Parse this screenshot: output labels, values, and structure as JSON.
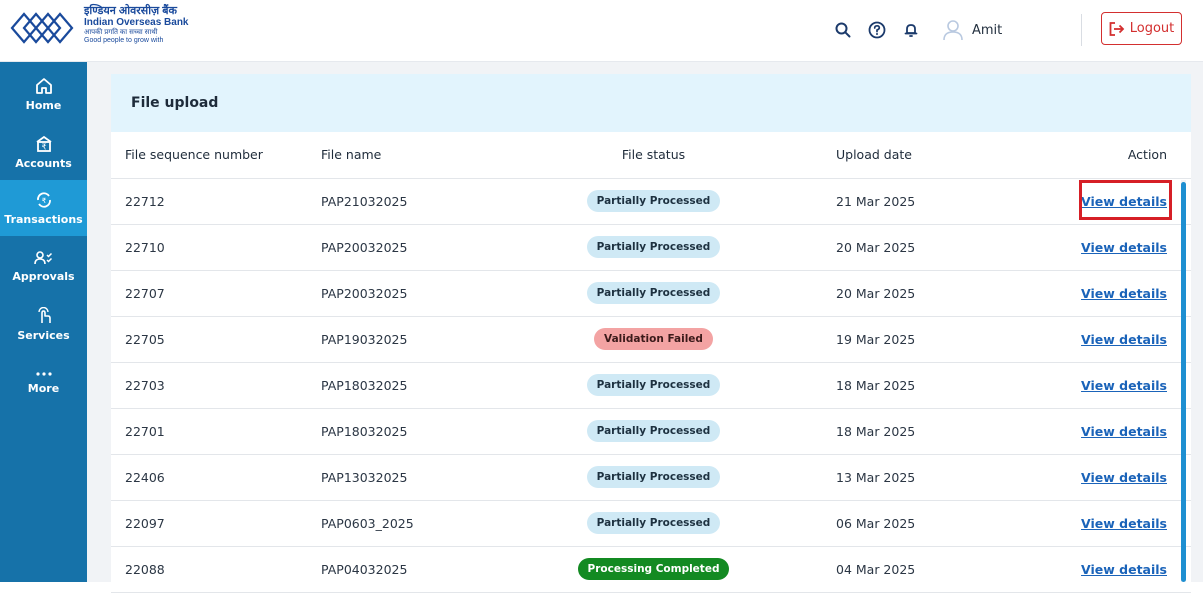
{
  "header": {
    "logo": {
      "hindi": "इण्डियन ओवरसीज़ बैंक",
      "english": "Indian Overseas Bank",
      "tagline_hindi": "आपकी प्रगति का सच्चा साथी",
      "tagline_english": "Good people to grow with"
    },
    "icons": [
      "search-icon",
      "help-icon",
      "bell-icon",
      "user-avatar-icon"
    ],
    "user_name": "Amit",
    "logout_label": "Logout"
  },
  "sidebar": {
    "items": [
      {
        "label": "Home",
        "icon": "home-icon"
      },
      {
        "label": "Accounts",
        "icon": "accounts-icon"
      },
      {
        "label": "Transactions",
        "icon": "transactions-icon",
        "active": true
      },
      {
        "label": "Approvals",
        "icon": "approvals-icon"
      },
      {
        "label": "Services",
        "icon": "services-icon"
      },
      {
        "label": "More",
        "icon": "more-icon"
      }
    ]
  },
  "panel": {
    "title": "File upload",
    "columns": [
      "File sequence number",
      "File name",
      "File status",
      "Upload date",
      "Action"
    ],
    "rows": [
      {
        "seq": "22712",
        "name": "PAP21032025",
        "status": "Partially Processed",
        "date": "21 Mar 2025",
        "action": "View details"
      },
      {
        "seq": "22710",
        "name": "PAP20032025",
        "status": "Partially Processed",
        "date": "20 Mar 2025",
        "action": "View details"
      },
      {
        "seq": "22707",
        "name": "PAP20032025",
        "status": "Partially Processed",
        "date": "20 Mar 2025",
        "action": "View details"
      },
      {
        "seq": "22705",
        "name": "PAP19032025",
        "status": "Validation Failed",
        "date": "19 Mar 2025",
        "action": "View details"
      },
      {
        "seq": "22703",
        "name": "PAP18032025",
        "status": "Partially Processed",
        "date": "18 Mar 2025",
        "action": "View details"
      },
      {
        "seq": "22701",
        "name": "PAP18032025",
        "status": "Partially Processed",
        "date": "18 Mar 2025",
        "action": "View details"
      },
      {
        "seq": "22406",
        "name": "PAP13032025",
        "status": "Partially Processed",
        "date": "13 Mar 2025",
        "action": "View details"
      },
      {
        "seq": "22097",
        "name": "PAP0603_2025",
        "status": "Partially Processed",
        "date": "06 Mar 2025",
        "action": "View details"
      },
      {
        "seq": "22088",
        "name": "PAP04032025",
        "status": "Processing Completed",
        "date": "04 Mar 2025",
        "action": "View details"
      }
    ]
  },
  "colors": {
    "brand_blue": "#1672a9",
    "active_nav": "#1f9ad6",
    "title_bar": "#e2f4fd",
    "logout_red": "#d32f2f",
    "link_blue": "#1a63b9",
    "status_partial": "#cfe9f5",
    "status_failed": "#f3a3a3",
    "status_completed": "#138a22"
  }
}
